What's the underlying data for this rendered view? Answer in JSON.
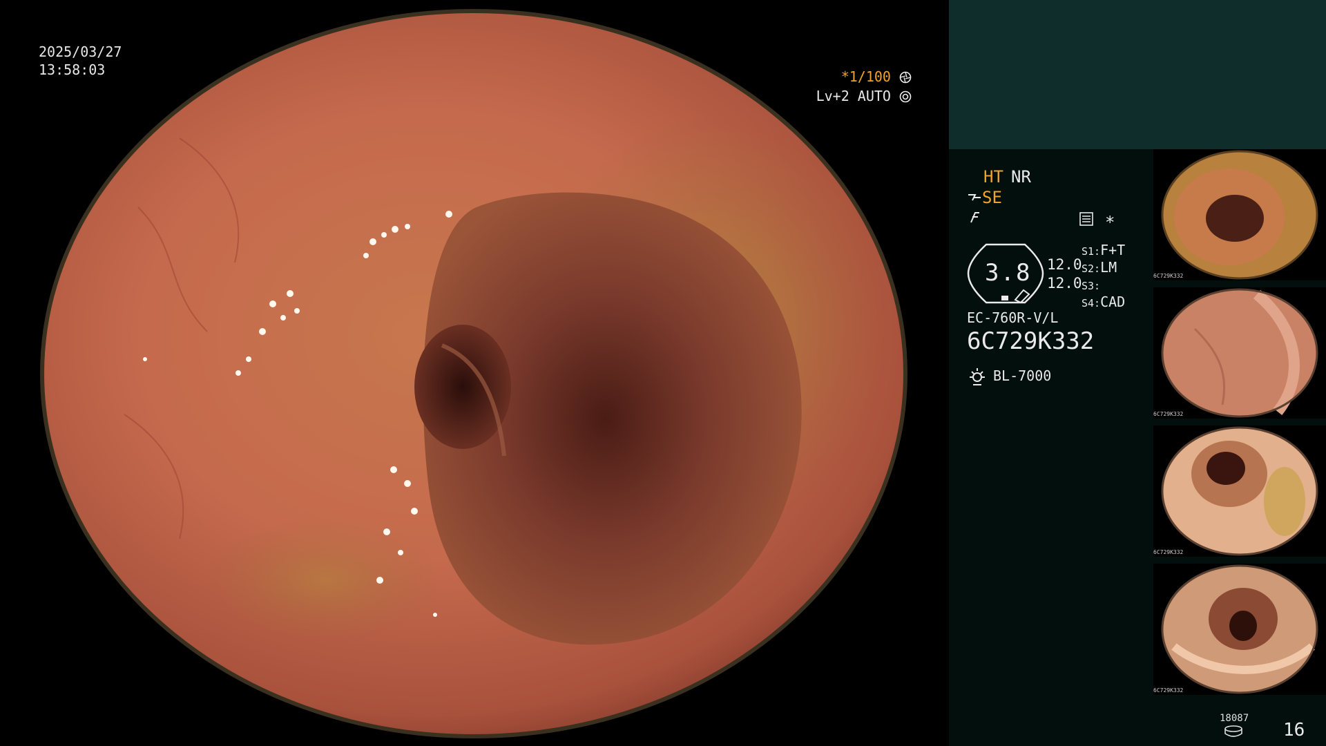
{
  "overlay": {
    "date": "2025/03/27",
    "time": "13:58:03",
    "shutter_prefix": "*",
    "shutter": "1/100",
    "iris": "Lv+2 AUTO"
  },
  "panel": {
    "mode_ht": "HT",
    "mode_nr": "NR",
    "structure_enhancement": "SE",
    "gauge_value": "3.8",
    "value_a": "12.0",
    "value_b": "12.0",
    "switches": [
      {
        "key": "S1:",
        "value": "F+T"
      },
      {
        "key": "S2:",
        "value": "LM"
      },
      {
        "key": "S3:",
        "value": ""
      },
      {
        "key": "S4:",
        "value": "CAD"
      }
    ],
    "scope_model": "EC-760R-V/L",
    "scope_serial": "6C729K332",
    "light_source": "BL-7000",
    "thumbnail_serial": "6C729K332",
    "storage_count": "18087",
    "image_count": "16"
  },
  "colors": {
    "accent": "#f1a32a",
    "panel_top": "#0f2e2b",
    "panel_body": "#020f0d",
    "text": "#eaeaea"
  },
  "icons": {
    "shutter": "aperture-icon",
    "iris": "iris-icon",
    "se": "structure-enhance-icon",
    "flash": "freeze-icon",
    "report": "report-icon",
    "light": "light-source-icon",
    "storage": "storage-icon"
  }
}
